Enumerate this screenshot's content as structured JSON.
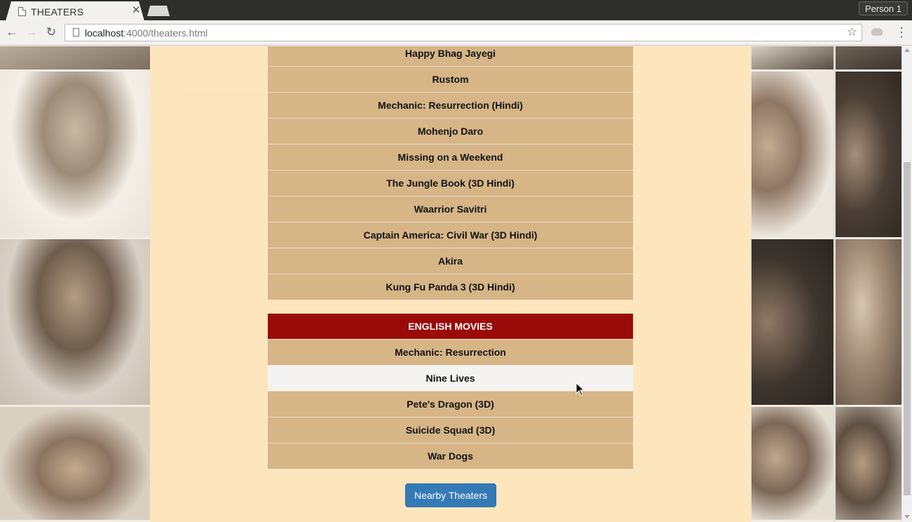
{
  "browser": {
    "tab_title": "THEATERS",
    "profile_label": "Person 1",
    "url_host": "localhost",
    "url_path": ":4000/theaters.html"
  },
  "hindi_movies": [
    "Happy Bhag Jayegi",
    "Rustom",
    "Mechanic: Resurrection (Hindi)",
    "Mohenjo Daro",
    "Missing on a Weekend",
    "The Jungle Book (3D Hindi)",
    "Waarrior Savitri",
    "Captain America: Civil War (3D Hindi)",
    "Akira",
    "Kung Fu Panda 3 (3D Hindi)"
  ],
  "english_section": {
    "header": "ENGLISH MOVIES",
    "movies": [
      "Mechanic: Resurrection",
      "Nine Lives",
      "Pete's Dragon (3D)",
      "Suicide Squad (3D)",
      "War Dogs"
    ],
    "hovered_index": 1
  },
  "nearby_button_label": "Nearby Theaters",
  "colors": {
    "header_bg": "#9a0a08",
    "button_bg": "#337ab7",
    "overlay": "#ffe4b5"
  }
}
